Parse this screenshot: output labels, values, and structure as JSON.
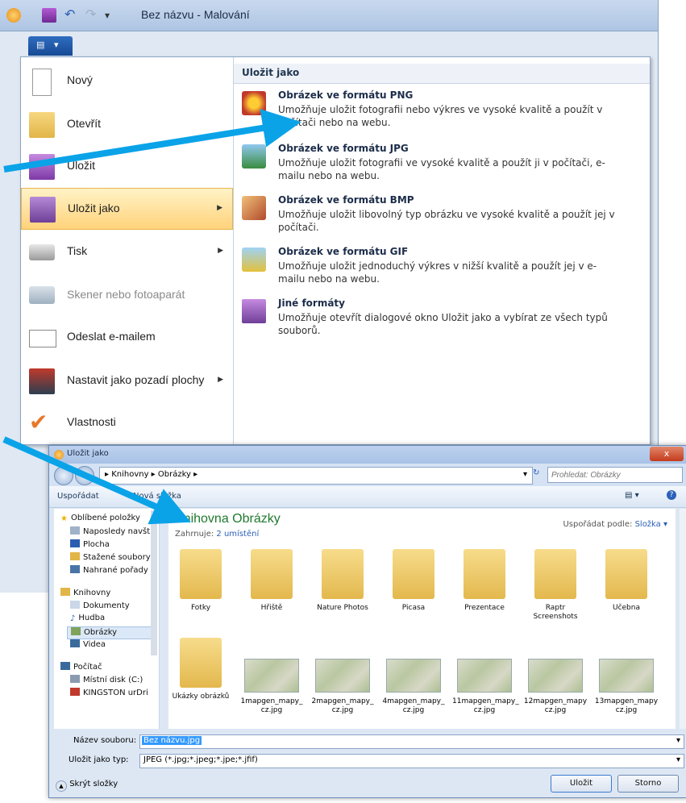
{
  "paint": {
    "window_title": "Bez názvu - Malování",
    "save_as_header": "Uložit jako",
    "menu_items": [
      {
        "label": "Nový"
      },
      {
        "label": "Otevřít"
      },
      {
        "label": "Uložit"
      },
      {
        "label": "Uložit jako",
        "active": true
      },
      {
        "label": "Tisk"
      },
      {
        "label": "Skener nebo fotoaparát",
        "disabled": true
      },
      {
        "label": "Odeslat e-mailem"
      },
      {
        "label": "Nastavit jako pozadí plochy"
      },
      {
        "label": "Vlastnosti"
      }
    ],
    "formats": [
      {
        "title": "Obrázek ve formátu PNG",
        "desc": "Umožňuje uložit fotografii nebo výkres ve vysoké kvalitě a použít v počítači nebo na webu."
      },
      {
        "title": "Obrázek ve formátu JPG",
        "desc": "Umožňuje uložit fotografii ve vysoké kvalitě a použít ji v počítači, e-mailu nebo na webu."
      },
      {
        "title": "Obrázek ve formátu BMP",
        "desc": "Umožňuje uložit libovolný typ obrázku ve vysoké kvalitě a použít jej v počítači."
      },
      {
        "title": "Obrázek ve formátu GIF",
        "desc": "Umožňuje uložit jednoduchý výkres v nižší kvalitě a použít jej v e-mailu nebo na webu."
      },
      {
        "title": "Jiné formáty",
        "desc": "Umožňuje otevřít dialogové okno Uložit jako a vybírat ze všech typů souborů."
      }
    ]
  },
  "dialog": {
    "title": "Uložit jako",
    "close": "x",
    "breadcrumb": "▸ Knihovny ▸ Obrázky ▸",
    "search_placeholder": "Prohledat: Obrázky",
    "toolbar": {
      "organize": "Uspořádat",
      "new_folder": "Nová složka"
    },
    "nav": [
      {
        "label": "Oblíbené položky"
      },
      {
        "label": "Naposledy navští"
      },
      {
        "label": "Plocha"
      },
      {
        "label": "Stažené soubory"
      },
      {
        "label": "Nahrané pořady"
      },
      {
        "label": "Knihovny"
      },
      {
        "label": "Dokumenty"
      },
      {
        "label": "Hudba"
      },
      {
        "label": "Obrázky",
        "selected": true
      },
      {
        "label": "Videa"
      },
      {
        "label": "Počítač"
      },
      {
        "label": "Místní disk (C:)"
      },
      {
        "label": "KINGSTON urDri"
      }
    ],
    "library_title": "Knihovna Obrázky",
    "library_includes": "Zahrnuje:",
    "library_locations": "2 umístění",
    "arrange_by": "Uspořádat podle:",
    "arrange_value": "Složka ▾",
    "folders": [
      "Fotky",
      "Hřiště",
      "Nature Photos",
      "Picasa",
      "Prezentace",
      "Raptr Screenshots",
      "Učebna",
      "Ukázky obrázků"
    ],
    "files": [
      "1mapgen_mapy_ cz.jpg",
      "2mapgen_mapy_ cz.jpg",
      "4mapgen_mapy_ cz.jpg",
      "11mapgen_mapy_ cz.jpg",
      "12mapgen_mapy cz.jpg",
      "13mapgen_mapy cz.jpg"
    ],
    "filename_label": "Název souboru:",
    "filename_value": "Bez názvu.jpg",
    "filetype_label": "Uložit jako typ:",
    "filetype_value": "JPEG (*.jpg;*.jpeg;*.jpe;*.jfif)",
    "hide_folders": "Skrýt složky",
    "save": "Uložit",
    "cancel": "Storno"
  },
  "colors": {
    "accent": "#0aa3e8",
    "folder": "#f3d27a",
    "active": "#ffd27a"
  }
}
